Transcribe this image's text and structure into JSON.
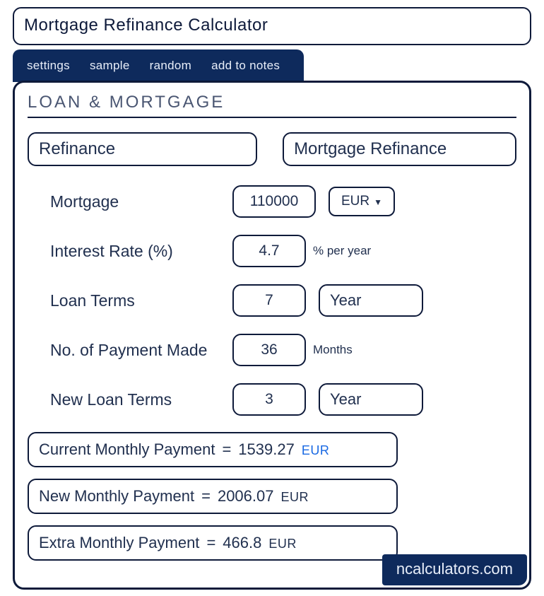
{
  "title": "Mortgage Refinance Calculator",
  "tabs": [
    "settings",
    "sample",
    "random",
    "add to notes"
  ],
  "section_title": "LOAN & MORTGAGE",
  "pills": {
    "left": "Refinance",
    "right": "Mortgage Refinance"
  },
  "inputs": {
    "mortgage": {
      "label": "Mortgage",
      "value": "110000",
      "currency": "EUR"
    },
    "interest": {
      "label": "Interest Rate (%)",
      "value": "4.7",
      "unit": "% per year"
    },
    "terms": {
      "label": "Loan Terms",
      "value": "7",
      "unit": "Year"
    },
    "payments": {
      "label": "No. of Payment Made",
      "value": "36",
      "unit": "Months"
    },
    "newterms": {
      "label": "New Loan Terms",
      "value": "3",
      "unit": "Year"
    }
  },
  "results": {
    "current": {
      "label": "Current Monthly Payment",
      "value": "1539.27",
      "unit": "EUR"
    },
    "new": {
      "label": "New Monthly Payment",
      "value": "2006.07",
      "unit": "EUR"
    },
    "extra": {
      "label": "Extra Monthly Payment",
      "value": "466.8",
      "unit": "EUR"
    }
  },
  "brand": "ncalculators.com",
  "equals": "="
}
